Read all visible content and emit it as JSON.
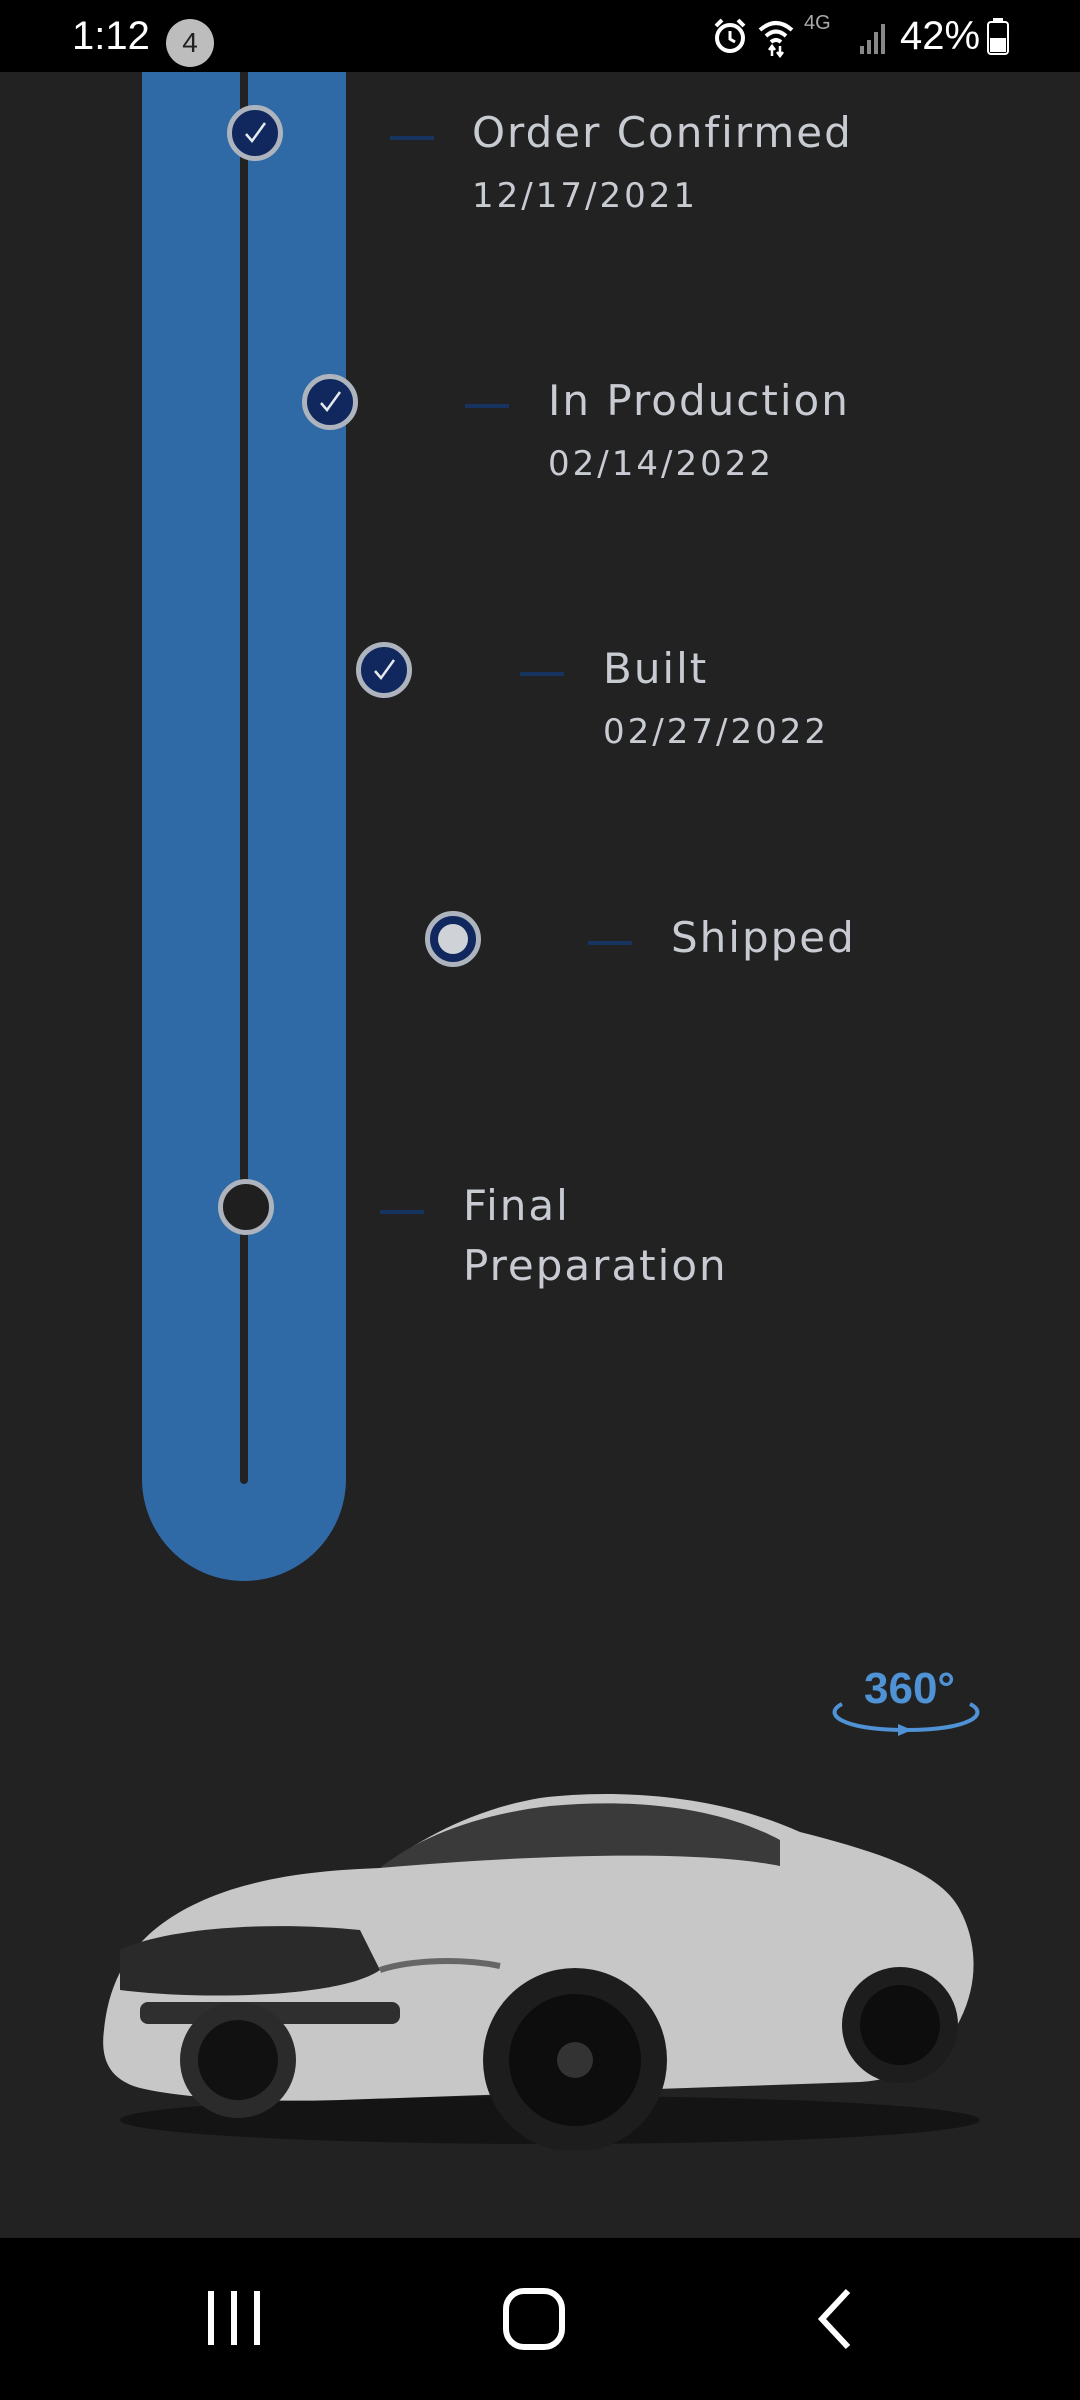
{
  "status_bar": {
    "time": "1:12",
    "notification_count": "4",
    "network": "4G",
    "battery": "42%",
    "icons": [
      "alarm-icon",
      "wifi-icon",
      "network-4g-icon",
      "signal-icon",
      "battery-icon"
    ]
  },
  "tracker": {
    "accent_color": "#2f6aa6",
    "steps": [
      {
        "title": "Order Confirmed",
        "date": "12/17/2021",
        "status": "complete"
      },
      {
        "title": "In Production",
        "date": "02/14/2022",
        "status": "complete"
      },
      {
        "title": "Built",
        "date": "02/27/2022",
        "status": "complete"
      },
      {
        "title": "Shipped",
        "date": "",
        "status": "current"
      },
      {
        "title": "Final Preparation",
        "date": "",
        "status": "pending"
      }
    ]
  },
  "vehicle": {
    "view_360_label": "360°",
    "view_360_color": "#4f93d6",
    "image": "white-mustang-gt-car"
  },
  "nav_bar": {
    "buttons": [
      "recent-apps-icon",
      "home-icon",
      "back-icon"
    ]
  }
}
